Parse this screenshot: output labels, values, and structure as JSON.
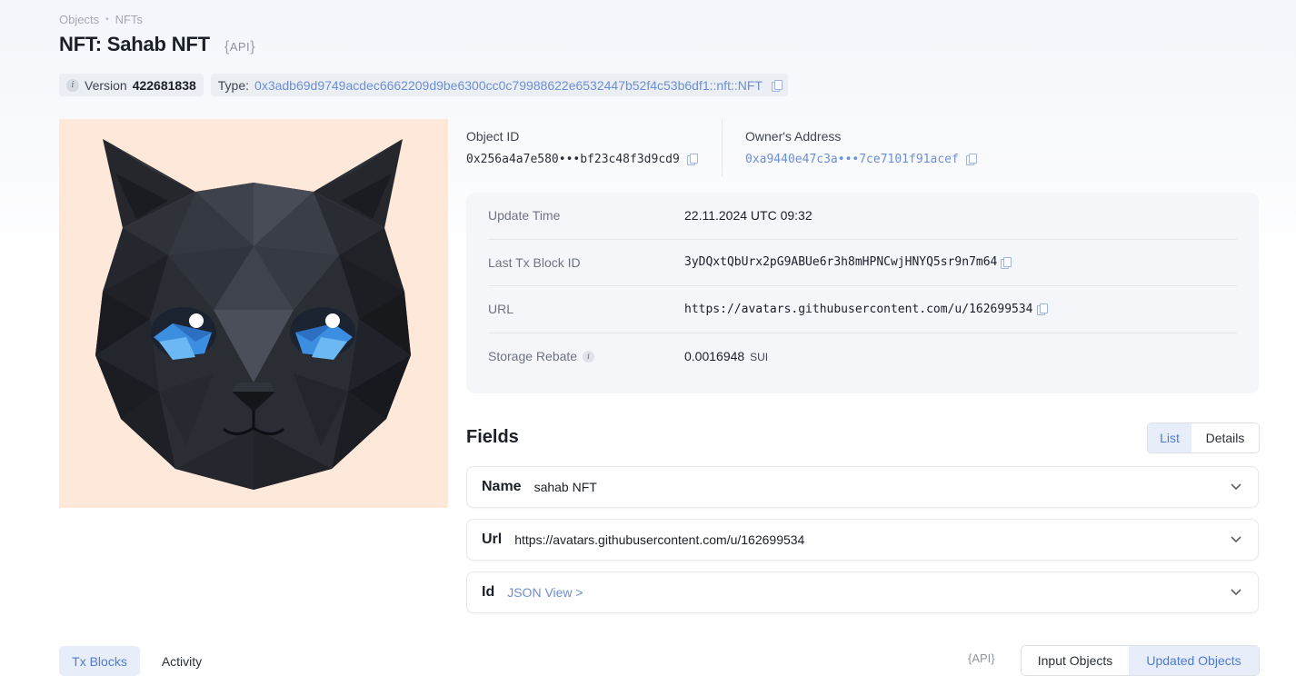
{
  "breadcrumb": {
    "items": [
      "Objects",
      "NFTs"
    ],
    "separator": "•"
  },
  "header": {
    "title": "NFT: Sahab NFT",
    "api_label": "API"
  },
  "meta": {
    "version_label": "Version",
    "version_value": "422681838",
    "type_label": "Type:",
    "type_value": "0x3adb69d9749acdec6662209d9be6300cc0c79988622e6532447b52f4c53b6df1::nft::NFT"
  },
  "object": {
    "label": "Object ID",
    "value": "0x256a4a7e580•••bf23c48f3d9cd9"
  },
  "owner": {
    "label": "Owner's Address",
    "value": "0xa9440e47c3a•••7ce7101f91acef"
  },
  "details": [
    {
      "label": "Update Time",
      "value": "22.11.2024 UTC 09:32"
    },
    {
      "label": "Last Tx Block ID",
      "value": "3yDQxtQbUrx2pG9ABUe6r3h8mHPNCwjHNYQ5sr9n7m64"
    },
    {
      "label": "URL",
      "value": "https://avatars.githubusercontent.com/u/162699534"
    },
    {
      "label": "Storage Rebate",
      "value": "0.0016948",
      "unit": "SUI"
    }
  ],
  "fields": {
    "title": "Fields",
    "view_toggle": {
      "list": "List",
      "details": "Details",
      "selected": "List"
    },
    "items": [
      {
        "name": "Name",
        "value": "sahab NFT"
      },
      {
        "name": "Url",
        "value": "https://avatars.githubusercontent.com/u/162699534"
      },
      {
        "name": "Id",
        "value": "JSON View >"
      }
    ]
  },
  "bottom_tabs": {
    "tx_blocks": "Tx Blocks",
    "activity": "Activity",
    "selected": "Tx Blocks"
  },
  "bottom_toggle": {
    "api_label": "API",
    "input": "Input Objects",
    "updated": "Updated Objects",
    "selected": "Updated Objects"
  },
  "image": {
    "subject": "cat-nft-image",
    "background": "#fde8da"
  },
  "colors": {
    "accent": "#6b8fd6",
    "active_bg": "#e7eef9",
    "card_bg": "#f4f6fa"
  }
}
